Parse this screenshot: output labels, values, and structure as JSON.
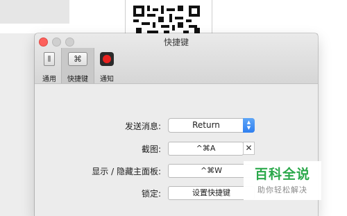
{
  "window": {
    "title": "快捷键"
  },
  "tabs": [
    {
      "label": "通用",
      "icon": "switch-icon"
    },
    {
      "label": "快捷键",
      "icon": "command-key-icon",
      "icon_glyph": "⌘",
      "selected": true
    },
    {
      "label": "通知",
      "icon": "record-icon"
    }
  ],
  "form": {
    "send_label": "发送消息:",
    "send_value": "Return",
    "screenshot_label": "截图:",
    "screenshot_value": "^⌘A",
    "clear_glyph": "✕",
    "toggle_panel_label": "显示 / 隐藏主面板:",
    "toggle_panel_value": "^⌘W",
    "lock_label": "锁定:",
    "lock_button": "设置快捷键"
  },
  "watermark": {
    "title": "百科全说",
    "subtitle": "助你轻松解决"
  },
  "colors": {
    "close": "#fc605c",
    "accent": "#2f7ff0",
    "watermark": "#2aa84a",
    "record": "#e8221f"
  }
}
